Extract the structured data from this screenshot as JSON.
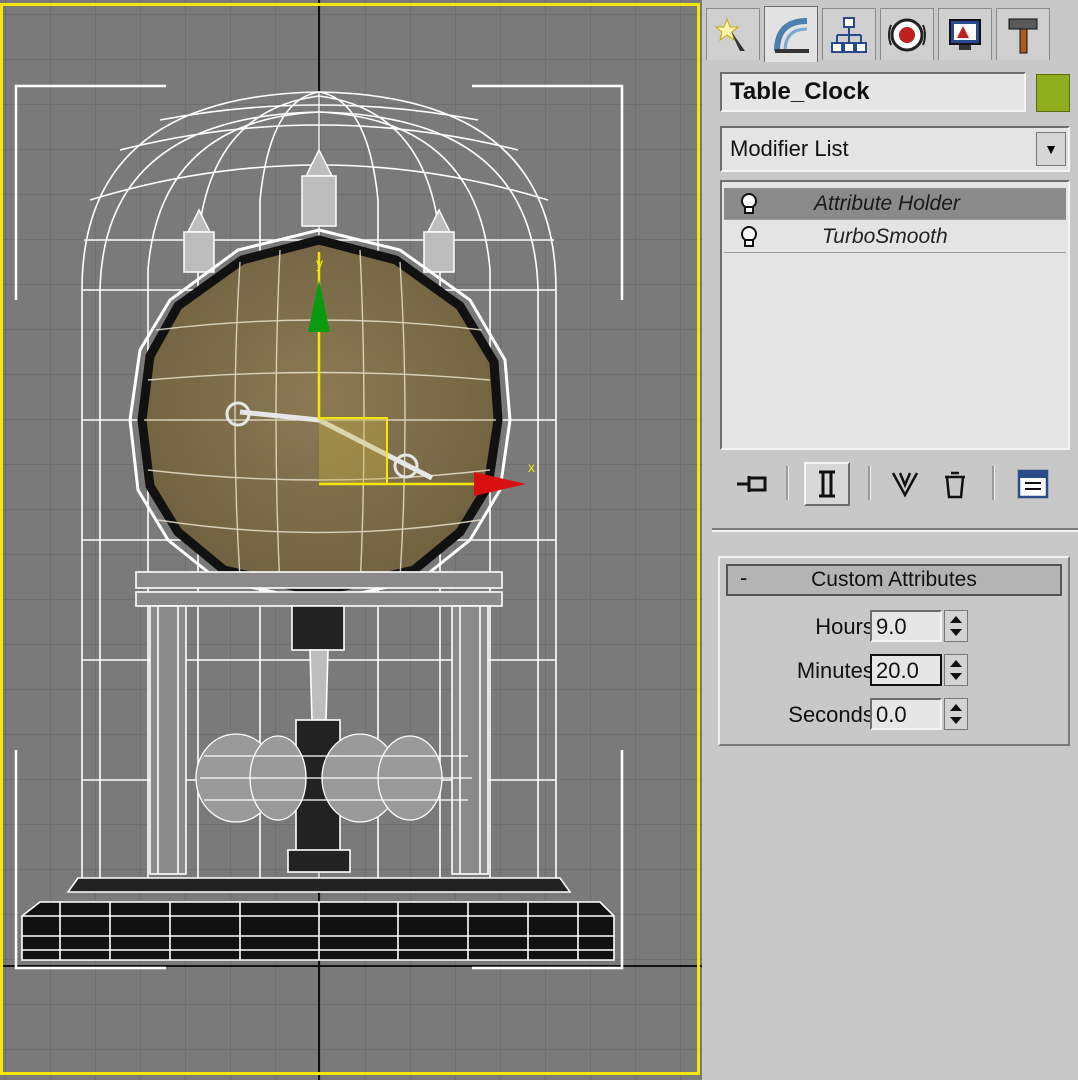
{
  "command_panel": {
    "tabs": [
      {
        "name": "create-tab",
        "icon": "create-star-cursor-icon"
      },
      {
        "name": "modify-tab",
        "icon": "modify-bend-icon"
      },
      {
        "name": "hierarchy-tab",
        "icon": "hierarchy-icon"
      },
      {
        "name": "motion-tab",
        "icon": "motion-icon"
      },
      {
        "name": "display-tab",
        "icon": "display-monitor-icon"
      },
      {
        "name": "utilities-tab",
        "icon": "hammer-icon"
      }
    ],
    "active_tab": "modify-tab",
    "object_name": "Table_Clock",
    "object_color": "#8fad1c",
    "modifier_list": "Modifier List",
    "stack": [
      {
        "label": "Attribute Holder",
        "selected": true
      },
      {
        "label": "TurboSmooth",
        "selected": false
      }
    ],
    "rollout": {
      "collapse": "-",
      "title": "Custom Attributes",
      "params": [
        {
          "label": "Hours:",
          "value": "9.0"
        },
        {
          "label": "Minutes:",
          "value": "20.0"
        },
        {
          "label": "Seconds:",
          "value": "0.0"
        }
      ]
    }
  },
  "viewport": {
    "active_border_color": "#f5e60a",
    "axis_colors": {
      "x": "#d81010",
      "y": "#0a9a10",
      "highlight": "#f5e60a"
    }
  }
}
